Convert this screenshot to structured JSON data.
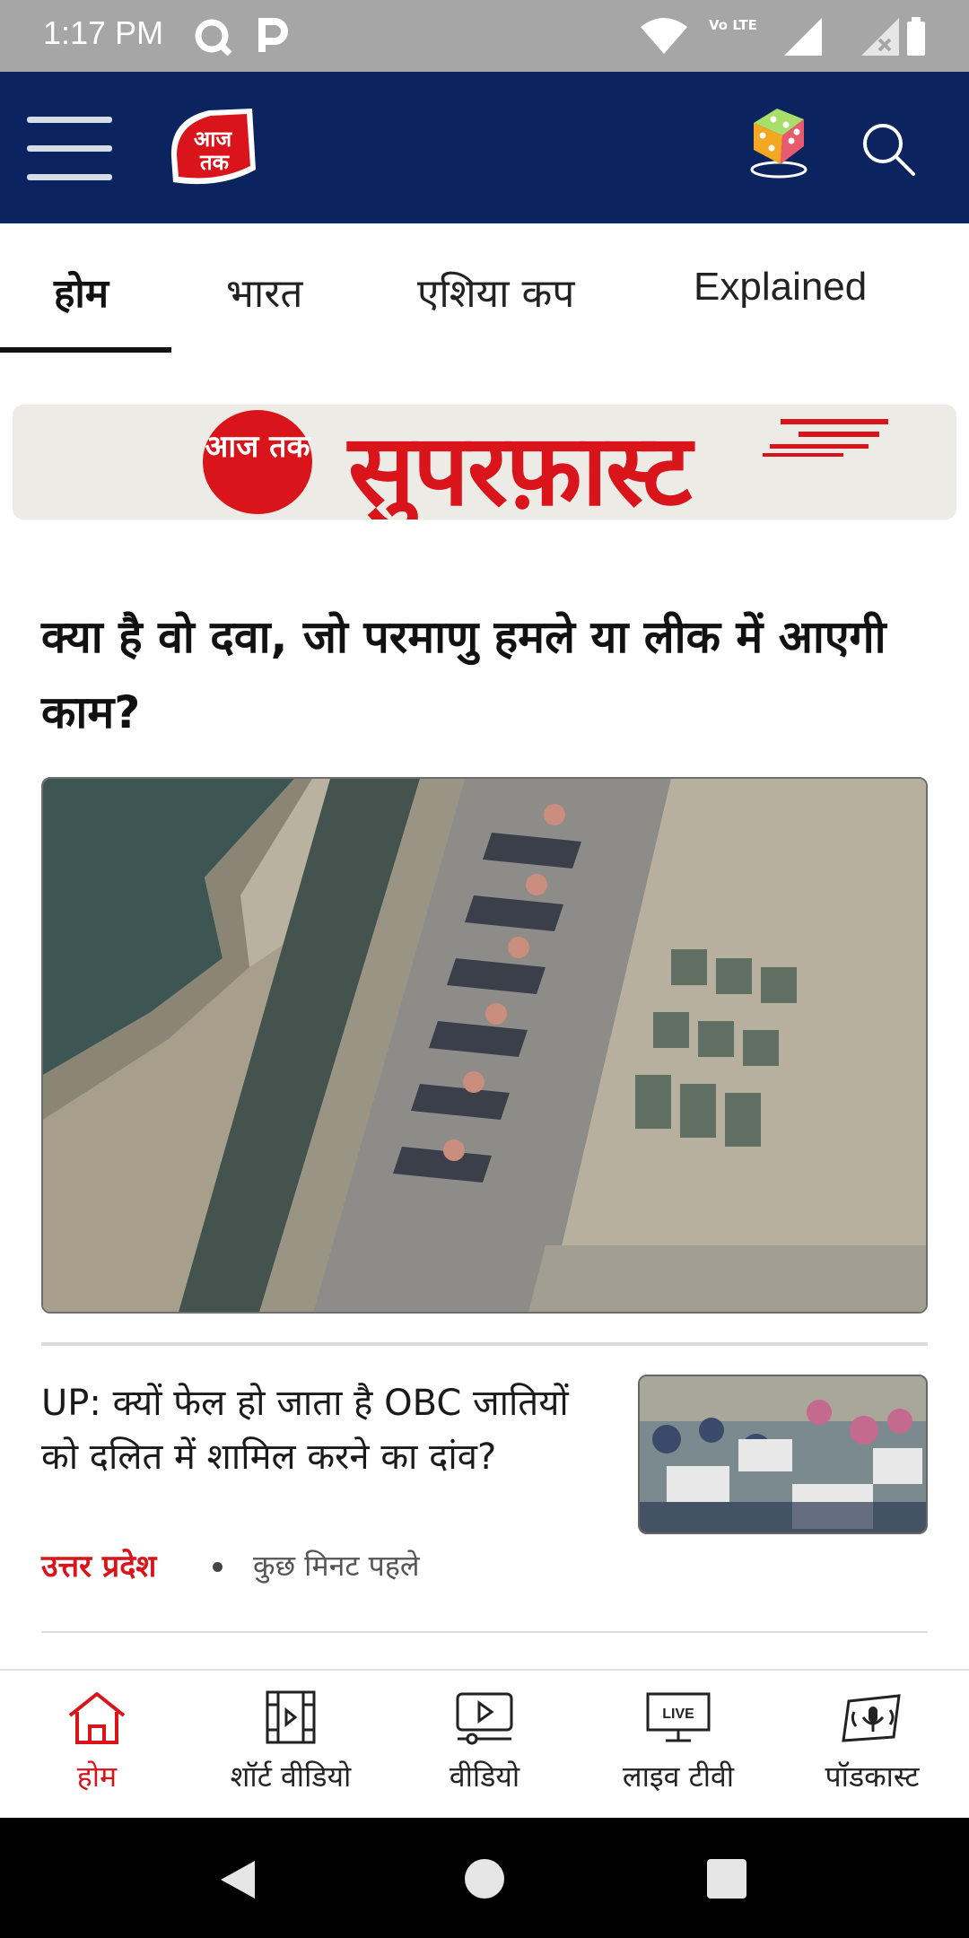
{
  "status": {
    "time": "1:17 PM",
    "volte": "Vo LTE"
  },
  "header": {
    "logo_text": "आज तक"
  },
  "tabs": [
    {
      "label": "होम",
      "active": true
    },
    {
      "label": "भारत"
    },
    {
      "label": "एशिया कप"
    },
    {
      "label": "Explained"
    }
  ],
  "banner": {
    "logo_text": "आज तक",
    "title": "सुपरफ़ास्ट"
  },
  "lead": {
    "headline": "क्या है वो दवा, जो परमाणु हमले या लीक में आएगी काम?"
  },
  "story": {
    "title": "UP: क्यों फेल हो जाता है OBC जातियों को दलित में शामिल करने का दांव?",
    "category": "उत्तर प्रदेश",
    "time": "कुछ मिनट पहले"
  },
  "bottom_nav": [
    {
      "label": "होम",
      "icon": "home-icon",
      "active": true
    },
    {
      "label": "शॉर्ट वीडियो",
      "icon": "short-video-icon"
    },
    {
      "label": "वीडियो",
      "icon": "video-icon"
    },
    {
      "label": "लाइव टीवी",
      "icon": "live-tv-icon",
      "badge": "LIVE"
    },
    {
      "label": "पॉडकास्ट",
      "icon": "podcast-icon"
    }
  ],
  "colors": {
    "header_bg": "#0b2460",
    "accent": "#d9141b",
    "statusbar": "#a6a6a6"
  }
}
